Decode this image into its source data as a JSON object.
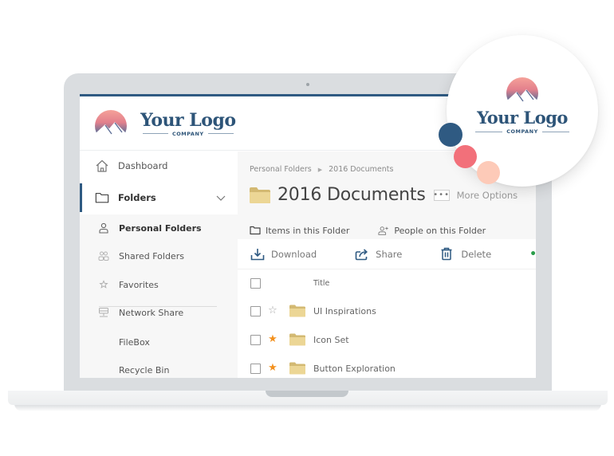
{
  "brand": {
    "logo_title": "Your Logo",
    "logo_subtitle": "COMPANY",
    "primary_color": "#2f5a82",
    "accent_dots": [
      "#2f5a82",
      "#f2707a",
      "#fdcab8"
    ]
  },
  "sidebar": {
    "items": [
      {
        "label": "Dashboard",
        "icon": "home-icon"
      },
      {
        "label": "Folders",
        "icon": "folder-icon",
        "expanded": true,
        "active": true
      }
    ],
    "subitems": [
      {
        "label": "Personal Folders",
        "icon": "user-icon",
        "current": true
      },
      {
        "label": "Shared Folders",
        "icon": "users-icon"
      },
      {
        "label": "Favorites",
        "icon": "star-icon"
      },
      {
        "label": "Network Share",
        "icon": "network-icon"
      },
      {
        "label": "FileBox"
      },
      {
        "label": "Recycle Bin"
      }
    ]
  },
  "main": {
    "breadcrumb": [
      "Personal Folders",
      "2016 Documents"
    ],
    "title": "2016 Documents",
    "more_options_label": "More Options",
    "more_options_dots": "•••",
    "tabs": [
      {
        "label": "Items in this Folder",
        "active": true
      },
      {
        "label": "People on this Folder"
      }
    ],
    "toolbar": {
      "download": "Download",
      "share": "Share",
      "delete": "Delete",
      "more": "••"
    },
    "list": {
      "column_title": "Title",
      "rows": [
        {
          "name": "UI Inspirations",
          "favorite": false,
          "star": "☆"
        },
        {
          "name": "Icon Set",
          "favorite": true,
          "star": "★"
        },
        {
          "name": "Button Exploration",
          "favorite": true,
          "star": "★"
        }
      ]
    }
  }
}
